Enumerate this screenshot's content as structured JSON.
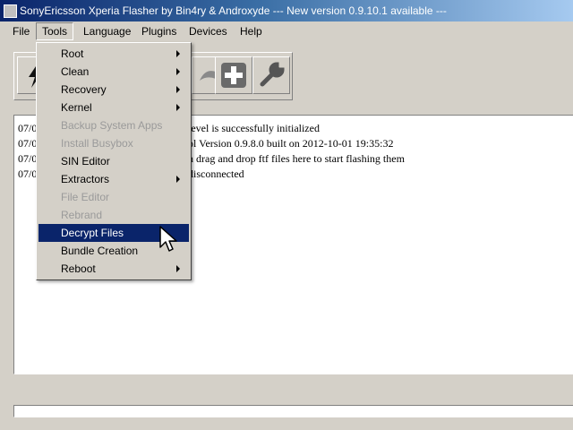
{
  "window": {
    "title": "SonyEricsson Xperia Flasher by Bin4ry & Androxyde     --- New version 0.9.10.1 available ---"
  },
  "menubar": {
    "items": [
      "File",
      "Tools",
      "Language",
      "Plugins",
      "Devices",
      "Help"
    ]
  },
  "tools_menu": {
    "items": [
      {
        "label": "Root",
        "state": "normal",
        "submenu": true
      },
      {
        "label": "Clean",
        "state": "normal",
        "submenu": true
      },
      {
        "label": "Recovery",
        "state": "normal",
        "submenu": true
      },
      {
        "label": "Kernel",
        "state": "normal",
        "submenu": true
      },
      {
        "label": "Backup System Apps",
        "state": "disabled",
        "submenu": false
      },
      {
        "label": "Install Busybox",
        "state": "disabled",
        "submenu": false
      },
      {
        "label": "SIN Editor",
        "state": "normal",
        "submenu": false
      },
      {
        "label": "Extractors",
        "state": "normal",
        "submenu": true
      },
      {
        "label": "File Editor",
        "state": "disabled",
        "submenu": false
      },
      {
        "label": "Rebrand",
        "state": "disabled",
        "submenu": false
      },
      {
        "label": "Decrypt Files",
        "state": "selected",
        "submenu": false
      },
      {
        "label": "Bundle Creation",
        "state": "normal",
        "submenu": false
      },
      {
        "label": "Reboot",
        "state": "normal",
        "submenu": true
      }
    ]
  },
  "toolbar": {
    "icons": [
      "flash-icon",
      "arrow-icon",
      "plus-icon",
      "wrench-icon"
    ]
  },
  "log": {
    "lines": [
      {
        "ts": "07/0",
        "msg": "level is successfully initialized"
      },
      {
        "ts": "07/0",
        "msg": "ol Version 0.9.8.0 built on 2012-10-01 19:35:32"
      },
      {
        "ts": "07/0",
        "msg": "n drag and drop ftf files here to start flashing them"
      },
      {
        "ts": "07/0",
        "msg": "disconnected"
      }
    ]
  },
  "colors": {
    "titlebar": "#0a246a",
    "face": "#d4d0c8",
    "highlight": "#0a246a"
  }
}
